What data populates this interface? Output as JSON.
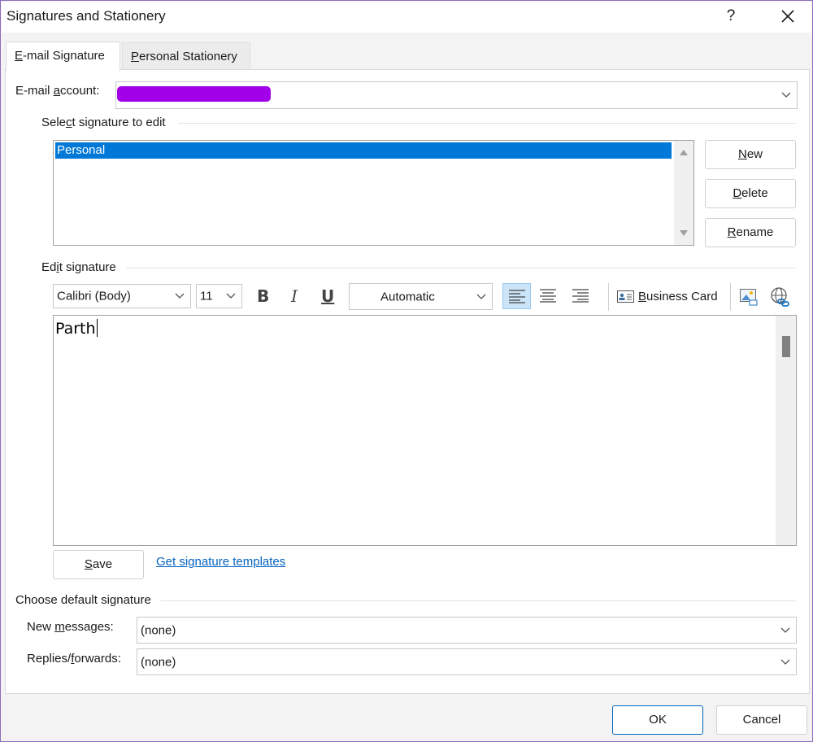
{
  "window": {
    "title": "Signatures and Stationery",
    "help_label": "?"
  },
  "tabs": [
    {
      "label": "E-mail Signature",
      "active": true
    },
    {
      "label": "Personal Stationery",
      "active": false
    }
  ],
  "account": {
    "label_prefix": "E-mail ",
    "label_key": "a",
    "label_suffix": "ccount:",
    "value": ""
  },
  "select_section": {
    "label_prefix": "Sele",
    "label_key": "c",
    "label_suffix": "t signature to edit",
    "items": [
      "Personal"
    ],
    "selected_index": 0
  },
  "signature_buttons": {
    "new": {
      "key": "N",
      "rest": "ew"
    },
    "delete": {
      "key": "D",
      "rest": "elete"
    },
    "rename": {
      "key": "R",
      "rest": "ename"
    }
  },
  "edit_section": {
    "label_prefix": "Ed",
    "label_key": "i",
    "label_suffix": "t signature",
    "font": "Calibri (Body)",
    "size": "11",
    "bold": "B",
    "italic": "I",
    "underline": "U",
    "color": "Automatic",
    "business_card": {
      "key": "B",
      "rest": "usiness Card"
    },
    "body_text": "Parth",
    "save": {
      "key": "S",
      "rest": "ave"
    },
    "templates_link": "Get signature templates"
  },
  "defaults": {
    "heading": "Choose default signature",
    "new_messages": {
      "prefix": "New ",
      "key": "m",
      "suffix": "essages:",
      "value": "(none)"
    },
    "replies": {
      "prefix": "Replies/",
      "key": "f",
      "suffix": "orwards:",
      "value": "(none)"
    }
  },
  "footer": {
    "ok": "OK",
    "cancel": "Cancel"
  },
  "colors": {
    "selection": "#0078d7",
    "link": "#0563c1",
    "redaction": "#a200e8",
    "window_border": "#8a6bbf"
  }
}
